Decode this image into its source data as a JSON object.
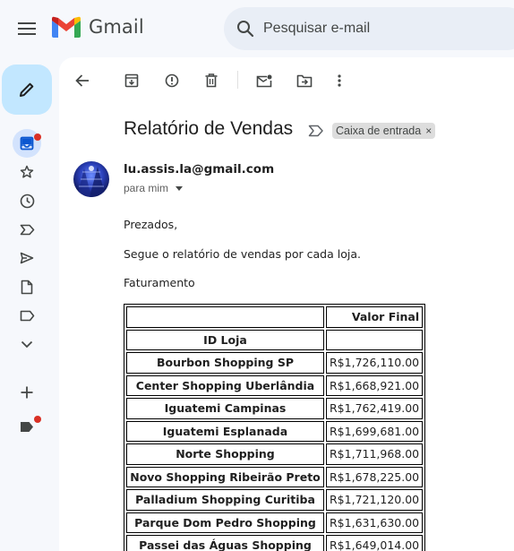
{
  "app": {
    "logo_text": "Gmail"
  },
  "search": {
    "placeholder": "Pesquisar e-mail"
  },
  "icons": {
    "menu": "hamburger-menu-icon",
    "search": "search-icon",
    "compose": "pencil-icon",
    "rail": [
      "inbox-icon",
      "star-icon",
      "clock-icon",
      "important-icon",
      "send-icon",
      "document-icon",
      "label-icon",
      "chevron-down-icon",
      "plus-icon",
      "label-filled-icon"
    ],
    "toolbar": [
      "back-arrow-icon",
      "archive-icon",
      "report-spam-icon",
      "trash-icon",
      "mark-unread-icon",
      "move-to-icon",
      "more-vert-icon"
    ]
  },
  "colors": {
    "accent": "#c2e7ff",
    "active": "#d3e3fd",
    "notification": "#d93025",
    "background": "#f6f8fc"
  },
  "email": {
    "subject": "Relatório de Vendas",
    "label": "Caixa de entrada",
    "label_close": "×",
    "sender": "lu.assis.la@gmail.com",
    "to": "para mim",
    "greeting": "Prezados,",
    "intro": "Segue o relatório de vendas por cada loja.",
    "section": "Faturamento"
  },
  "table": {
    "header_value": "Valor Final",
    "header_id": "ID Loja",
    "rows": [
      {
        "store": "Bourbon Shopping SP",
        "value": "R$1,726,110.00"
      },
      {
        "store": "Center Shopping Uberlândia",
        "value": "R$1,668,921.00"
      },
      {
        "store": "Iguatemi Campinas",
        "value": "R$1,762,419.00"
      },
      {
        "store": "Iguatemi Esplanada",
        "value": "R$1,699,681.00"
      },
      {
        "store": "Norte Shopping",
        "value": "R$1,711,968.00"
      },
      {
        "store": "Novo Shopping Ribeirão Preto",
        "value": "R$1,678,225.00"
      },
      {
        "store": "Palladium Shopping Curitiba",
        "value": "R$1,721,120.00"
      },
      {
        "store": "Parque Dom Pedro Shopping",
        "value": "R$1,631,630.00"
      },
      {
        "store": "Passei das Águas Shopping",
        "value": "R$1,649,014.00"
      }
    ]
  }
}
